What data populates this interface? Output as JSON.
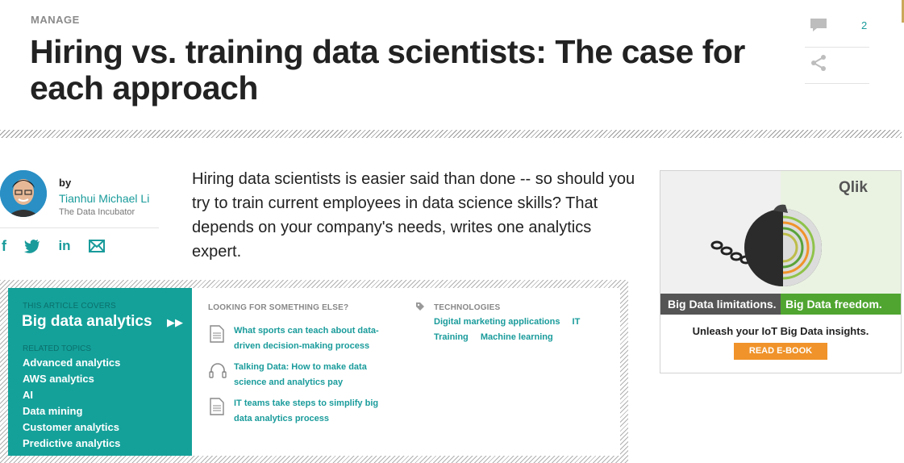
{
  "header": {
    "kicker": "MANAGE",
    "title": "Hiring vs. training data scientists: The case for each approach",
    "comment_count": "2"
  },
  "author": {
    "by": "by",
    "name": "Tianhui Michael Li",
    "org": "The Data Incubator"
  },
  "share_icons": [
    "facebook-icon",
    "twitter-icon",
    "linkedin-icon",
    "email-icon"
  ],
  "dek": "Hiring data scientists is easier said than done -- so should you try to train current employees in data science skills? That depends on your company's needs, writes one analytics expert.",
  "topic_box": {
    "covers_label": "THIS ARTICLE COVERS",
    "topic": "Big data analytics",
    "related_label": "RELATED TOPICS",
    "related": [
      "Advanced analytics",
      "AWS analytics",
      "AI",
      "Data mining",
      "Customer analytics",
      "Predictive analytics"
    ],
    "looking_label": "LOOKING FOR SOMETHING ELSE?",
    "items": [
      {
        "text": "What sports can teach about data-driven decision-making process",
        "icon": "document-icon"
      },
      {
        "text": "Talking Data: How to make data science and analytics pay",
        "icon": "headphones-icon"
      },
      {
        "text": "IT teams take steps to simplify big data analytics process",
        "icon": "document-icon"
      }
    ],
    "tech_label": "TECHNOLOGIES",
    "tech": [
      "Digital marketing applications",
      "IT",
      "Training",
      "Machine learning"
    ]
  },
  "ad": {
    "brand": "Qlik",
    "band_left": "Big Data limitations.",
    "band_right": "Big Data freedom.",
    "line": "Unleash your IoT Big Data insights.",
    "button": "READ E-BOOK"
  },
  "colors": {
    "accent": "#1a9b9b",
    "teal_panel": "#14a19a",
    "ad_green": "#4fa530",
    "ad_orange": "#f0932a"
  }
}
